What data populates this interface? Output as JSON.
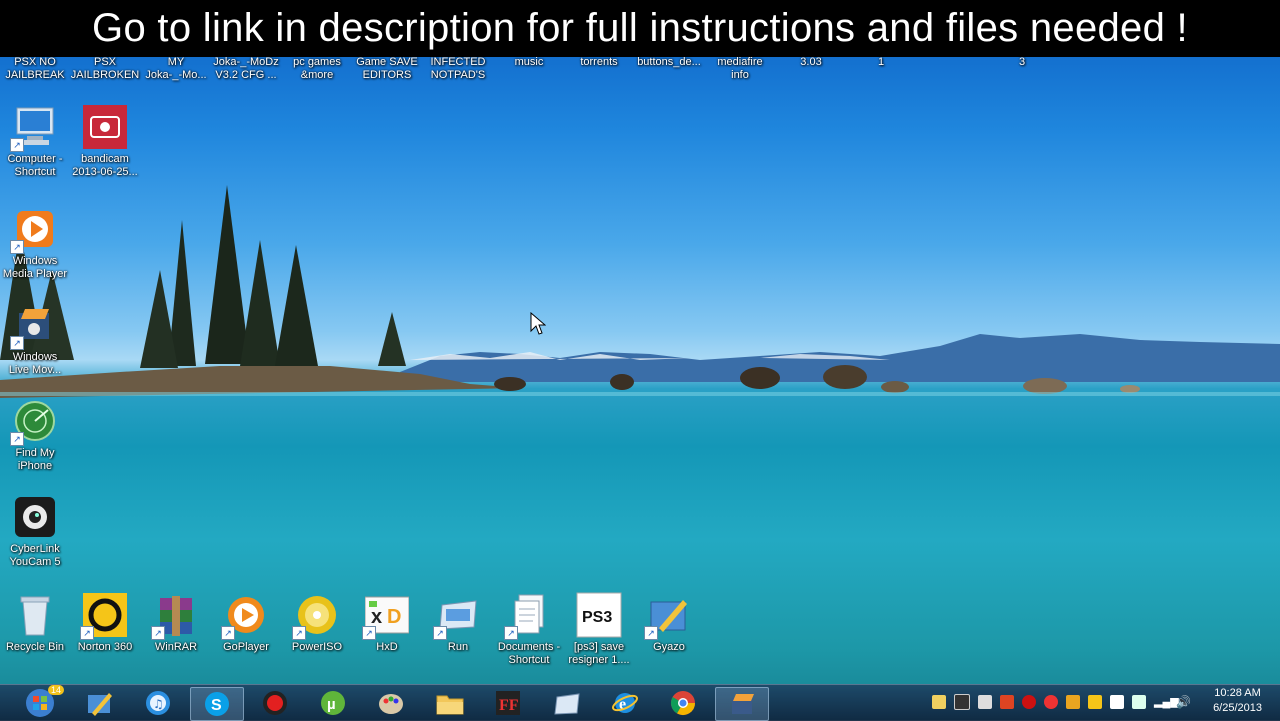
{
  "caption": "Go to link in description for full instructions and files needed !",
  "top_labels": [
    "PSX NO\nJAILBREAK",
    "PSX\nJAILBROKEN",
    "MY\nJoka-_-Mo...",
    "Joka-_-MoDz\nV3.2 CFG ...",
    "pc games\n&more",
    "Game SAVE\nEDITORS",
    "INFECTED\nNOTPAD'S",
    "music",
    "torrents",
    "buttons_de...",
    "mediafire\ninfo",
    "3.03",
    "1",
    "3"
  ],
  "left_icons": [
    {
      "label": "Computer -\nShortcut",
      "icon": "computer-icon"
    },
    {
      "label": "bandicam\n2013-06-25...",
      "icon": "bandicam-icon"
    },
    {
      "label": "Windows\nMedia Player",
      "icon": "media-player-icon"
    },
    {
      "label": "Windows\nLive Mov...",
      "icon": "movie-maker-icon"
    },
    {
      "label": "Find My\niPhone",
      "icon": "find-iphone-icon"
    },
    {
      "label": "CyberLink\nYouCam 5",
      "icon": "webcam-icon"
    }
  ],
  "bottom_icons": [
    {
      "label": "Recycle Bin",
      "icon": "recycle-bin-icon"
    },
    {
      "label": "Norton 360",
      "icon": "norton-icon"
    },
    {
      "label": "WinRAR",
      "icon": "winrar-icon"
    },
    {
      "label": "GoPlayer",
      "icon": "goplayer-icon"
    },
    {
      "label": "PowerISO",
      "icon": "poweriso-icon"
    },
    {
      "label": "HxD",
      "icon": "hxd-icon"
    },
    {
      "label": "Run",
      "icon": "run-icon"
    },
    {
      "label": "Documents -\nShortcut",
      "icon": "documents-icon"
    },
    {
      "label": "[ps3] save\nresigner 1....",
      "icon": "ps3-icon"
    },
    {
      "label": "Gyazo",
      "icon": "gyazo-icon"
    }
  ],
  "start_badge": "14",
  "clock": {
    "time": "10:28 AM",
    "date": "6/25/2013"
  }
}
